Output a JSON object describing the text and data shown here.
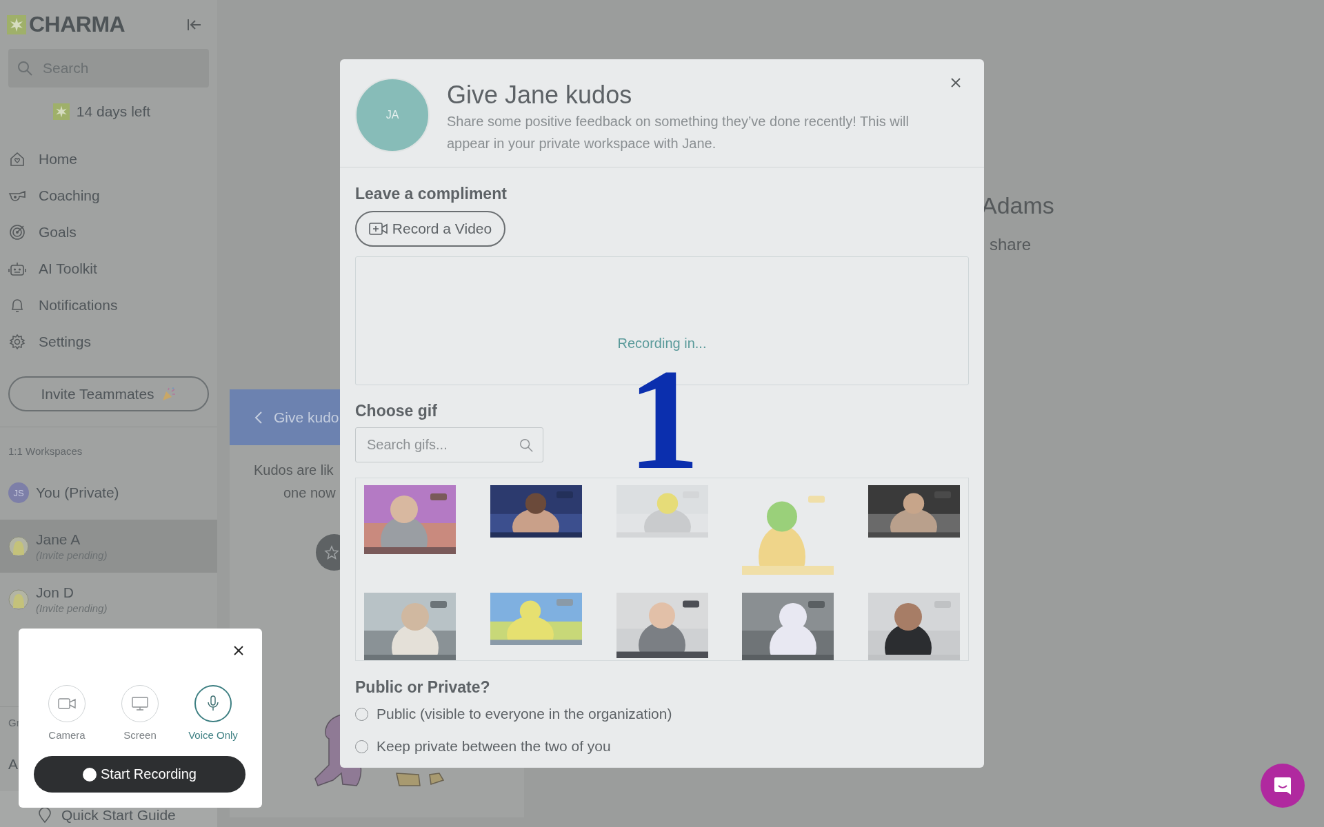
{
  "sidebar": {
    "logo": "CHARMA",
    "search_placeholder": "Search",
    "trial": "14 days left",
    "nav": [
      {
        "label": "Home",
        "kind": "home"
      },
      {
        "label": "Coaching",
        "kind": "coaching"
      },
      {
        "label": "Goals",
        "kind": "goals"
      },
      {
        "label": "AI Toolkit",
        "kind": "robot"
      },
      {
        "label": "Notifications",
        "kind": "bell"
      },
      {
        "label": "Settings",
        "kind": "gear"
      }
    ],
    "invite_button": "Invite Teammates",
    "workspaces_heading": "1:1 Workspaces",
    "workspaces": [
      {
        "name": "You (Private)",
        "kind": "initials",
        "initials": "JS",
        "selected": false
      },
      {
        "name": "Jane A",
        "note": "(Invite pending)",
        "kind": "illustration",
        "selected": true
      },
      {
        "name": "Jon D",
        "note": "(Invite pending)",
        "kind": "illustration",
        "selected": false
      }
    ],
    "section_2_heading": "Gr",
    "section_2_item": "A",
    "quick_start": "Quick Start Guide"
  },
  "background": {
    "heading": "Adams",
    "subheading": "share",
    "panel": {
      "title": "Give kudo",
      "text_lines": [
        "Kudos are lik",
        "one now"
      ]
    }
  },
  "modal": {
    "avatar_initials": "JA",
    "title": "Give Jane kudos",
    "description": "Share some positive feedback on something they’ve done recently! This will appear in your private workspace with Jane.",
    "compliment_label": "Leave a compliment",
    "record_button": "Record a Video",
    "recording_status": "Recording in...",
    "gif_label": "Choose gif",
    "gif_search_placeholder": "Search gifs...",
    "visibility_label": "Public or Private?",
    "visibility_options": [
      {
        "label": "Public (visible to everyone in the organization)",
        "selected": false
      },
      {
        "label": "Keep private between the two of you",
        "selected": false
      }
    ]
  },
  "countdown": "1",
  "recorder": {
    "options": [
      {
        "label": "Camera",
        "kind": "camera",
        "selected": false
      },
      {
        "label": "Screen",
        "kind": "screen",
        "selected": false
      },
      {
        "label": "Voice Only",
        "kind": "mic",
        "selected": true
      }
    ],
    "start_button": "Start Recording"
  }
}
